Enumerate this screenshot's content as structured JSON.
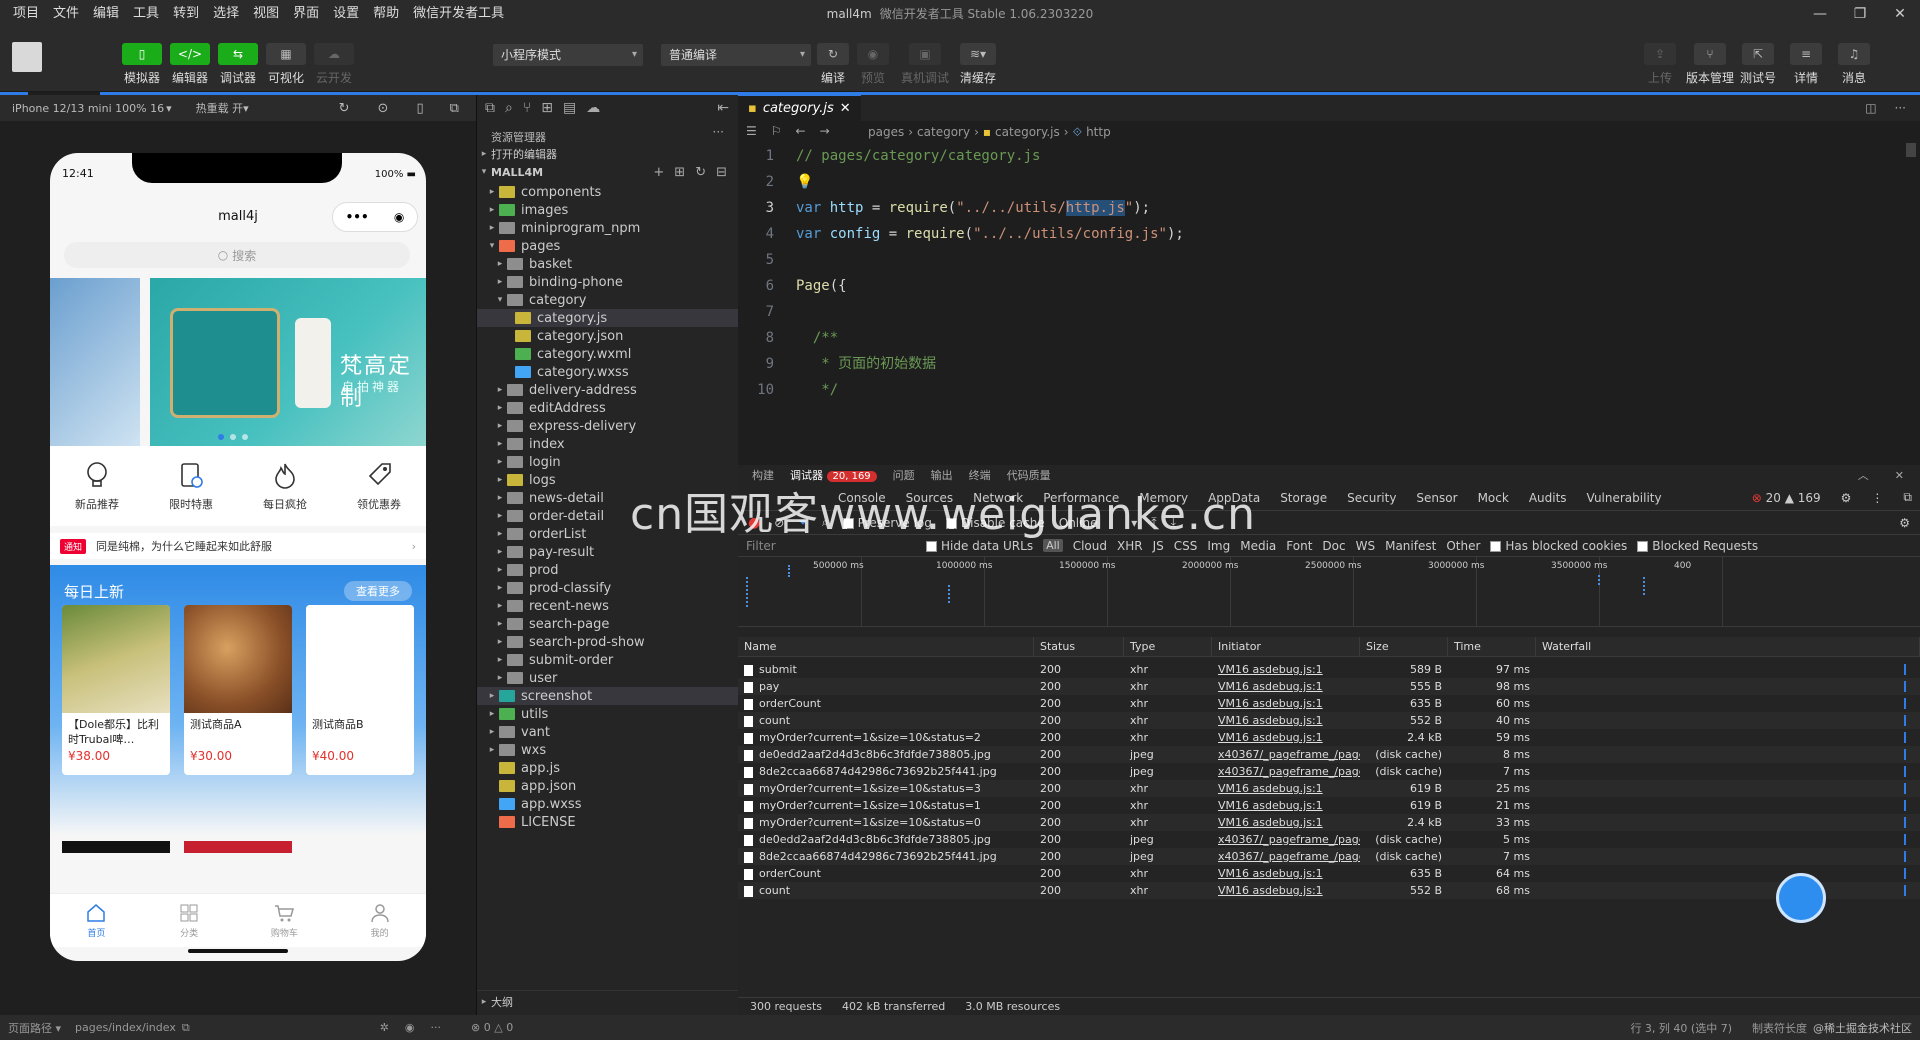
{
  "menus": [
    "项目",
    "文件",
    "编辑",
    "工具",
    "转到",
    "选择",
    "视图",
    "界面",
    "设置",
    "帮助",
    "微信开发者工具"
  ],
  "window": {
    "project": "mall4m",
    "app": "微信开发者工具 Stable 1.06.2303220"
  },
  "toolbar": {
    "left": [
      {
        "label": "模拟器",
        "icon": "phone-icon"
      },
      {
        "label": "编辑器",
        "icon": "code-icon"
      },
      {
        "label": "调试器",
        "icon": "debug-icon"
      },
      {
        "label": "可视化",
        "icon": "layout-icon"
      },
      {
        "label": "云开发",
        "icon": "cloud-icon"
      }
    ],
    "mode": "小程序模式",
    "compile": "普通编译",
    "center": [
      {
        "label": "编译"
      },
      {
        "label": "预览"
      },
      {
        "label": "真机调试"
      },
      {
        "label": "清缓存"
      }
    ],
    "right": [
      {
        "label": "上传"
      },
      {
        "label": "版本管理"
      },
      {
        "label": "测试号"
      },
      {
        "label": "详情"
      },
      {
        "label": "消息"
      }
    ]
  },
  "simulator": {
    "device": "iPhone 12/13 mini 100% 16",
    "hotreload": "热重载 开",
    "time": "12:41",
    "battery": "100%",
    "title": "mall4j",
    "search": "搜索",
    "banner_text": "梵高定制",
    "banner_sub": "自拍神器",
    "cats": [
      "新品推荐",
      "限时特惠",
      "每日疯抢",
      "领优惠券"
    ],
    "notice_tag": "通知",
    "notice": "同是纯棉，为什么它睡起来如此舒服",
    "daily_title": "每日上新",
    "daily_more": "查看更多",
    "products": [
      {
        "name": "【Dole都乐】比利时Trubal啤…",
        "price": "¥38.00"
      },
      {
        "name": "测试商品A",
        "price": "¥30.00"
      },
      {
        "name": "测试商品B",
        "price": "¥40.00"
      }
    ],
    "tabs": [
      "首页",
      "分类",
      "购物车",
      "我的"
    ]
  },
  "explorer": {
    "title": "资源管理器",
    "open_editors": "打开的编辑器",
    "root": "MALL4M",
    "tree": [
      {
        "name": "components",
        "depth": 1,
        "arrow": "▸",
        "color": "y"
      },
      {
        "name": "images",
        "depth": 1,
        "arrow": "▸",
        "color": "g"
      },
      {
        "name": "miniprogram_npm",
        "depth": 1,
        "arrow": "▸",
        "color": ""
      },
      {
        "name": "pages",
        "depth": 1,
        "arrow": "▾",
        "color": "o"
      },
      {
        "name": "basket",
        "depth": 2,
        "arrow": "▸",
        "color": ""
      },
      {
        "name": "binding-phone",
        "depth": 2,
        "arrow": "▸",
        "color": ""
      },
      {
        "name": "category",
        "depth": 2,
        "arrow": "▾",
        "color": ""
      },
      {
        "name": "category.js",
        "depth": 3,
        "arrow": "",
        "color": "y",
        "active": true
      },
      {
        "name": "category.json",
        "depth": 3,
        "arrow": "",
        "color": "y"
      },
      {
        "name": "category.wxml",
        "depth": 3,
        "arrow": "",
        "color": "g"
      },
      {
        "name": "category.wxss",
        "depth": 3,
        "arrow": "",
        "color": "b"
      },
      {
        "name": "delivery-address",
        "depth": 2,
        "arrow": "▸",
        "color": ""
      },
      {
        "name": "editAddress",
        "depth": 2,
        "arrow": "▸",
        "color": ""
      },
      {
        "name": "express-delivery",
        "depth": 2,
        "arrow": "▸",
        "color": ""
      },
      {
        "name": "index",
        "depth": 2,
        "arrow": "▸",
        "color": ""
      },
      {
        "name": "login",
        "depth": 2,
        "arrow": "▸",
        "color": ""
      },
      {
        "name": "logs",
        "depth": 2,
        "arrow": "▸",
        "color": "y"
      },
      {
        "name": "news-detail",
        "depth": 2,
        "arrow": "▸",
        "color": ""
      },
      {
        "name": "order-detail",
        "depth": 2,
        "arrow": "▸",
        "color": ""
      },
      {
        "name": "orderList",
        "depth": 2,
        "arrow": "▸",
        "color": ""
      },
      {
        "name": "pay-result",
        "depth": 2,
        "arrow": "▸",
        "color": ""
      },
      {
        "name": "prod",
        "depth": 2,
        "arrow": "▸",
        "color": ""
      },
      {
        "name": "prod-classify",
        "depth": 2,
        "arrow": "▸",
        "color": ""
      },
      {
        "name": "recent-news",
        "depth": 2,
        "arrow": "▸",
        "color": ""
      },
      {
        "name": "search-page",
        "depth": 2,
        "arrow": "▸",
        "color": ""
      },
      {
        "name": "search-prod-show",
        "depth": 2,
        "arrow": "▸",
        "color": ""
      },
      {
        "name": "submit-order",
        "depth": 2,
        "arrow": "▸",
        "color": ""
      },
      {
        "name": "user",
        "depth": 2,
        "arrow": "▸",
        "color": ""
      },
      {
        "name": "screenshot",
        "depth": 1,
        "arrow": "▸",
        "color": "t",
        "active": true
      },
      {
        "name": "utils",
        "depth": 1,
        "arrow": "▸",
        "color": "g"
      },
      {
        "name": "vant",
        "depth": 1,
        "arrow": "▸",
        "color": ""
      },
      {
        "name": "wxs",
        "depth": 1,
        "arrow": "▸",
        "color": ""
      },
      {
        "name": "app.js",
        "depth": 1,
        "arrow": "",
        "color": "y"
      },
      {
        "name": "app.json",
        "depth": 1,
        "arrow": "",
        "color": "y"
      },
      {
        "name": "app.wxss",
        "depth": 1,
        "arrow": "",
        "color": "b"
      },
      {
        "name": "LICENSE",
        "depth": 1,
        "arrow": "",
        "color": "o"
      }
    ],
    "outline": "大纲"
  },
  "editor": {
    "tab": "category.js",
    "breadcrumb": [
      "pages",
      "category",
      "category.js",
      "http"
    ],
    "lines": [
      "1",
      "2",
      "3",
      "4",
      "5",
      "6",
      "7",
      "8",
      "9",
      "10"
    ]
  },
  "devtools": {
    "top_tabs": [
      "构建",
      "调试器",
      "问题",
      "输出",
      "终端",
      "代码质量"
    ],
    "badge": "20, 169",
    "tabs": [
      "Console",
      "Sources",
      "Network",
      "Performance",
      "Memory",
      "AppData",
      "Storage",
      "Security",
      "Sensor",
      "Mock",
      "Audits",
      "Vulnerability"
    ],
    "counts": "20 ▲ 169",
    "preserve": "Preserve log",
    "disable_cache": "Disable cache",
    "online": "Online",
    "filter": "Filter",
    "hide_data": "Hide data URLs",
    "all": "All",
    "types": [
      "Cloud",
      "XHR",
      "JS",
      "CSS",
      "Img",
      "Media",
      "Font",
      "Doc",
      "WS",
      "Manifest",
      "Other"
    ],
    "blocked_cookies": "Has blocked cookies",
    "blocked_req": "Blocked Requests",
    "ticks": [
      "500000 ms",
      "1000000 ms",
      "1500000 ms",
      "2000000 ms",
      "2500000 ms",
      "3000000 ms",
      "3500000 ms",
      "400"
    ],
    "cols": [
      "Name",
      "Status",
      "Type",
      "Initiator",
      "Size",
      "Time",
      "Waterfall"
    ],
    "rows": [
      {
        "name": "submit",
        "status": "200",
        "type": "xhr",
        "init": "VM16 asdebug.js:1",
        "size": "589 B",
        "time": "97 ms"
      },
      {
        "name": "pay",
        "status": "200",
        "type": "xhr",
        "init": "VM16 asdebug.js:1",
        "size": "555 B",
        "time": "98 ms"
      },
      {
        "name": "orderCount",
        "status": "200",
        "type": "xhr",
        "init": "VM16 asdebug.js:1",
        "size": "635 B",
        "time": "60 ms"
      },
      {
        "name": "count",
        "status": "200",
        "type": "xhr",
        "init": "VM16 asdebug.js:1",
        "size": "552 B",
        "time": "40 ms"
      },
      {
        "name": "myOrder?current=1&size=10&status=2",
        "status": "200",
        "type": "xhr",
        "init": "VM16 asdebug.js:1",
        "size": "2.4 kB",
        "time": "59 ms"
      },
      {
        "name": "de0edd2aaf2d4d3c8b6c3fdfde738805.jpg",
        "status": "200",
        "type": "jpeg",
        "init": "x40367/_pageframe_/pages/...",
        "size": "(disk cache)",
        "time": "8 ms"
      },
      {
        "name": "8de2ccaa66874d42986c73692b25f441.jpg",
        "status": "200",
        "type": "jpeg",
        "init": "x40367/_pageframe_/pages/...",
        "size": "(disk cache)",
        "time": "7 ms"
      },
      {
        "name": "myOrder?current=1&size=10&status=3",
        "status": "200",
        "type": "xhr",
        "init": "VM16 asdebug.js:1",
        "size": "619 B",
        "time": "25 ms"
      },
      {
        "name": "myOrder?current=1&size=10&status=1",
        "status": "200",
        "type": "xhr",
        "init": "VM16 asdebug.js:1",
        "size": "619 B",
        "time": "21 ms"
      },
      {
        "name": "myOrder?current=1&size=10&status=0",
        "status": "200",
        "type": "xhr",
        "init": "VM16 asdebug.js:1",
        "size": "2.4 kB",
        "time": "33 ms"
      },
      {
        "name": "de0edd2aaf2d4d3c8b6c3fdfde738805.jpg",
        "status": "200",
        "type": "jpeg",
        "init": "x40367/_pageframe_/pages/...",
        "size": "(disk cache)",
        "time": "5 ms"
      },
      {
        "name": "8de2ccaa66874d42986c73692b25f441.jpg",
        "status": "200",
        "type": "jpeg",
        "init": "x40367/_pageframe_/pages/...",
        "size": "(disk cache)",
        "time": "7 ms"
      },
      {
        "name": "orderCount",
        "status": "200",
        "type": "xhr",
        "init": "VM16 asdebug.js:1",
        "size": "635 B",
        "time": "64 ms"
      },
      {
        "name": "count",
        "status": "200",
        "type": "xhr",
        "init": "VM16 asdebug.js:1",
        "size": "552 B",
        "time": "68 ms"
      }
    ],
    "summary": [
      "300 requests",
      "402 kB transferred",
      "3.0 MB resources"
    ]
  },
  "statusbar": {
    "path_label": "页面路径",
    "path": "pages/index/index",
    "errors": "0 △ 0",
    "pos": "行 3, 列 40 (选中 7)",
    "indent": "制表符长度",
    "watermark_corner": "@稀土掘金技术社区"
  },
  "watermark": "cn国观客www.weiguanke.cn",
  "colors": {
    "accent": "#2f7ce6",
    "green": "#1aad19",
    "error": "#d32f2f"
  }
}
